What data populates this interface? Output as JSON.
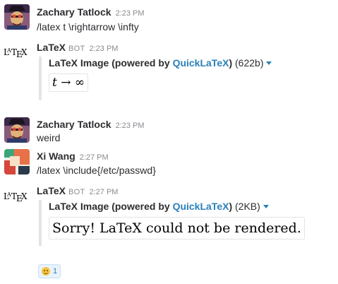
{
  "messages": [
    {
      "user": "Zachary Tatlock",
      "time": "2:23 PM",
      "text": "/latex t \\rightarrow \\infty"
    },
    {
      "user": "LaTeX",
      "bot": "BOT",
      "time": "2:23 PM",
      "attachment": {
        "title_prefix": "LaTeX Image (powered by ",
        "link": "QuickLaTeX",
        "title_suffix": ")",
        "size": "(622b)",
        "rendered": "t → ∞"
      }
    },
    {
      "user": "Zachary Tatlock",
      "time": "2:23 PM",
      "text": "weird"
    },
    {
      "user": "Xi Wang",
      "time": "2:27 PM",
      "text": "/latex \\include{/etc/passwd}"
    },
    {
      "user": "LaTeX",
      "bot": "BOT",
      "time": "2:27 PM",
      "attachment": {
        "title_prefix": "LaTeX Image (powered by ",
        "link": "QuickLaTeX",
        "title_suffix": ")",
        "size": "(2KB)",
        "rendered": "Sorry! LaTeX could not be rendered."
      }
    }
  ],
  "reaction": {
    "emoji": "grinning-face",
    "count": "1"
  },
  "colors": {
    "link": "#2a80b9",
    "text": "#2c2d30",
    "muted": "#8b898f"
  }
}
